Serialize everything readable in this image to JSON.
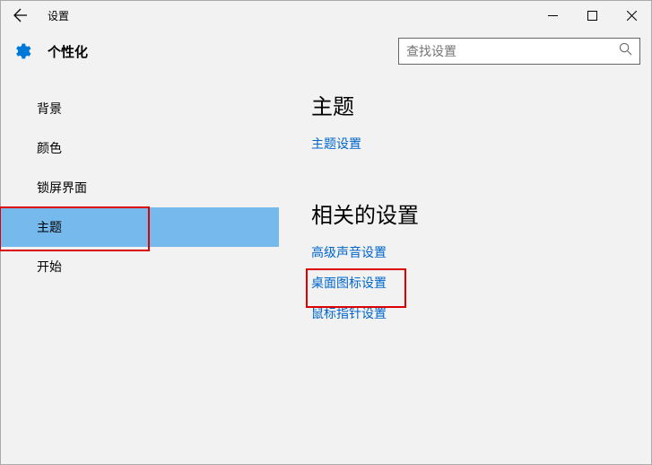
{
  "window": {
    "title": "设置"
  },
  "header": {
    "category": "个性化",
    "search_placeholder": "查找设置"
  },
  "sidebar": {
    "items": [
      {
        "label": "背景"
      },
      {
        "label": "颜色"
      },
      {
        "label": "锁屏界面"
      },
      {
        "label": "主题"
      },
      {
        "label": "开始"
      }
    ]
  },
  "content": {
    "heading1": "主题",
    "link_theme_settings": "主题设置",
    "heading2": "相关的设置",
    "link_sound": "高级声音设置",
    "link_desktop_icons": "桌面图标设置",
    "link_mouse": "鼠标指针设置"
  }
}
